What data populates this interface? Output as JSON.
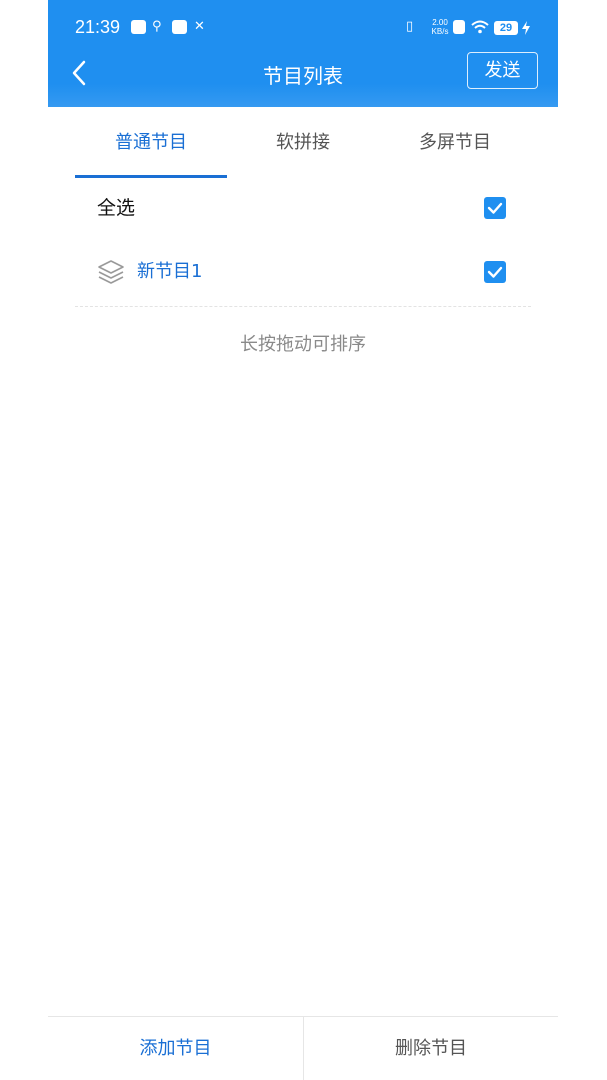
{
  "status_bar": {
    "time": "21:39",
    "net_speed_value": "2.00",
    "net_speed_unit": "KB/s",
    "battery": "29"
  },
  "navbar": {
    "title": "节目列表",
    "send_label": "发送"
  },
  "tabs": [
    {
      "label": "普通节目",
      "active": true
    },
    {
      "label": "软拼接",
      "active": false
    },
    {
      "label": "多屏节目",
      "active": false
    }
  ],
  "list": {
    "select_all_label": "全选",
    "select_all_checked": true,
    "items": [
      {
        "name": "新节目1",
        "icon": "layers-icon",
        "checked": true
      }
    ]
  },
  "hint": "长按拖动可排序",
  "bottom_bar": {
    "add_label": "添加节目",
    "delete_label": "删除节目"
  },
  "colors": {
    "header": "#1f8ff0",
    "accent": "#1a6fd4"
  }
}
